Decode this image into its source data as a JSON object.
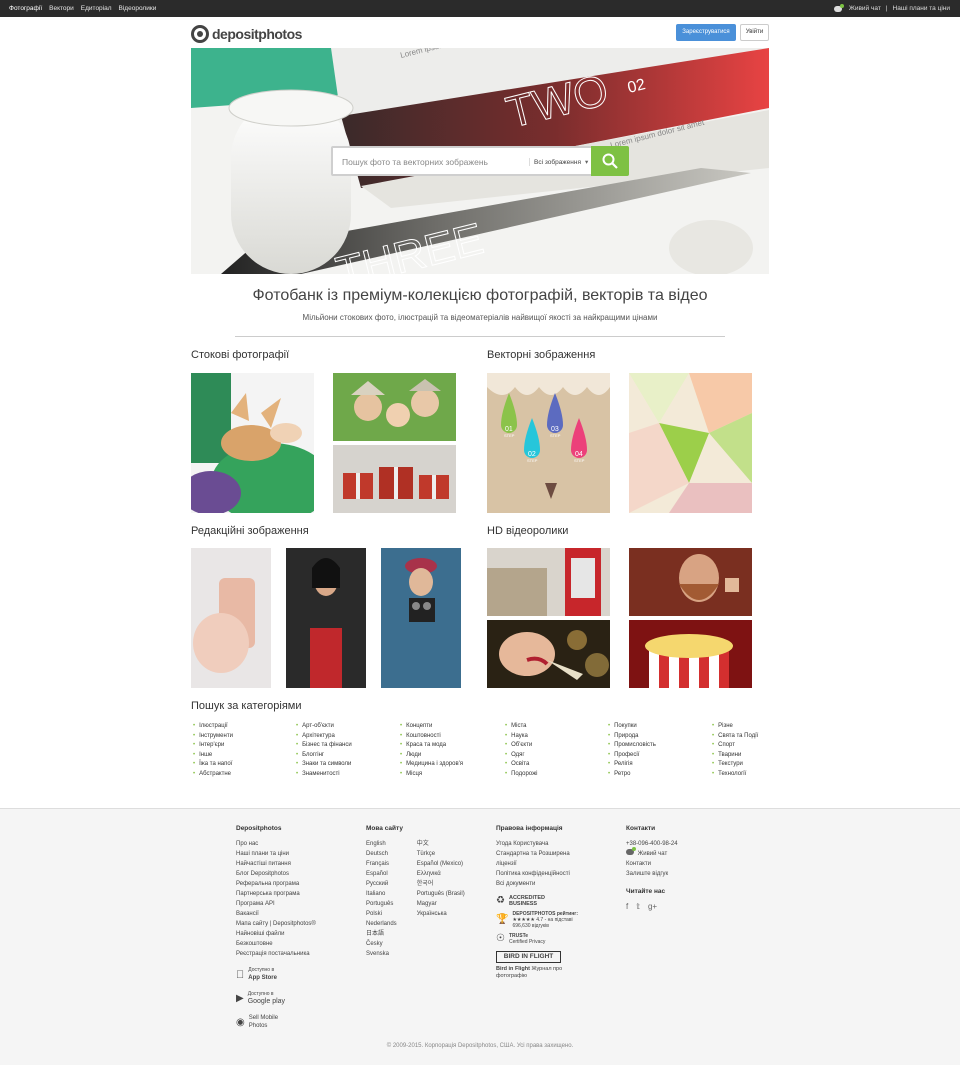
{
  "topbar": {
    "nav": [
      "Фотографії",
      "Вектори",
      "Едиторіал",
      "Відеоролики"
    ],
    "live_chat": "Живий чат",
    "plans": "Наші плани та ціни"
  },
  "header": {
    "logo_text": "depositphotos",
    "register": "Зареєструватися",
    "login": "Увійти"
  },
  "hero": {
    "search_placeholder": "Пошук фото та векторних зображень",
    "search_scope": "Всі зображення",
    "ribbon_text_1": "TWO",
    "ribbon_num": "02",
    "ribbon_lorem_1": "Lorem ipsum",
    "ribbon_lorem_2": "Lorem ipsum dolor sit amet",
    "ribbon_text_2": "THREE"
  },
  "headline": "Фотобанк із преміум-колекцією фотографій, векторів та відео",
  "subline": "Мільйони стокових фото, ілюстрацій та відеоматеріалів найвищої якості за найкращими цінами",
  "sections": {
    "stock": "Стокові фотографії",
    "vector": "Векторні зображення",
    "editorial": "Редакційні зображення",
    "video": "HD відеоролики"
  },
  "vector_steps": [
    "01",
    "02",
    "03",
    "04"
  ],
  "vector_step_label": "STEP",
  "categories": {
    "title": "Пошук за категоріями",
    "columns": [
      [
        "Ілюстрації",
        "Інструменти",
        "Інтер'єри",
        "Інше",
        "Їжа та напої",
        "Абстрактне"
      ],
      [
        "Арт-об'єкти",
        "Архітектура",
        "Бізнес та фінанси",
        "Блоггінг",
        "Знаки та символи",
        "Знаменитості"
      ],
      [
        "Концепти",
        "Коштовності",
        "Краса та мода",
        "Люди",
        "Медицина і здоров'я",
        "Місця"
      ],
      [
        "Міста",
        "Наука",
        "Об'єкти",
        "Одяг",
        "Освіта",
        "Подорожі"
      ],
      [
        "Покупки",
        "Природа",
        "Промисловість",
        "Професії",
        "Релігія",
        "Ретро"
      ],
      [
        "Різне",
        "Свята та Події",
        "Спорт",
        "Тварини",
        "Текстури",
        "Технології"
      ]
    ]
  },
  "footer": {
    "col1": {
      "title": "Depositphotos",
      "links": [
        "Про нас",
        "Наші плани та ціни",
        "Найчастіші питання",
        "Блог Depositphotos",
        "Реферальна програма",
        "Партнерська програма",
        "Програма API",
        "Вакансії",
        "Мапа сайту | Depositphotos®",
        "Найновіші файли",
        "Безкоштовне",
        "Реєстрація постачальника"
      ]
    },
    "apps": [
      {
        "pre": "Доступно в",
        "name": "App Store"
      },
      {
        "pre": "Доступно в",
        "name": "Google play"
      },
      {
        "pre": "Sell Mobile",
        "name": "Photos"
      }
    ],
    "col2": {
      "title": "Мова сайту",
      "left": [
        "English",
        "Deutsch",
        "Français",
        "Español",
        "Русский",
        "Italiano",
        "Português",
        "Polski",
        "Nederlands",
        "日本語",
        "Česky",
        "Svenska"
      ],
      "right": [
        "中文",
        "Türkçe",
        "Español (Mexico)",
        "Ελληνικά",
        "한국어",
        "Português (Brasil)",
        "Magyar",
        "Українська"
      ]
    },
    "col3": {
      "title": "Правова інформація",
      "links": [
        "Угода Користувача",
        "Стандартна та Розширена ліцензії",
        "Політика конфіденційності",
        "Всі документи"
      ],
      "bbb_1": "ACCREDITED",
      "bbb_2": "BUSINESS",
      "rating_title": "DEPOSITPHOTOS рейтинг:",
      "rating_score": "4.7 - на підставі",
      "rating_count": "696,630 відгуків",
      "truste": "TRUSTe",
      "truste_sub": "Certified Privacy",
      "bird": "BIRD IN FLIGHT",
      "bird_caption_1": "Bird in Flight",
      "bird_caption_2": "Журнал про фотографію"
    },
    "col4": {
      "title": "Контакти",
      "phone": "+38-096-400-98-24",
      "chat": "Живий чат",
      "contacts": "Контакти",
      "feedback": "Залиште відгук",
      "follow": "Читайте нас"
    },
    "copyright": "© 2009-2015. Корпорація Depositphotos, США. Усі права захищено."
  },
  "colors": {
    "accent_green": "#7ec143",
    "button_blue": "#4a90d9",
    "ribbon_red": "#e84343",
    "ribbon_teal": "#3db38d"
  }
}
